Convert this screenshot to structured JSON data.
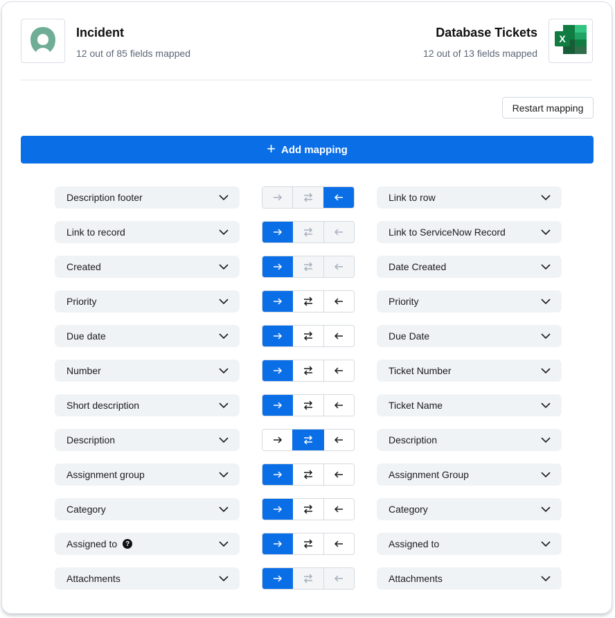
{
  "source": {
    "title": "Incident",
    "subtitle": "12 out of 85 fields mapped",
    "icon": "servicenow-logo-icon",
    "icon_color": "#6fad96"
  },
  "target": {
    "title": "Database Tickets",
    "subtitle": "12 out of 13 fields mapped",
    "icon": "excel-logo-icon"
  },
  "actions": {
    "restart_label": "Restart mapping",
    "add_label": "Add mapping",
    "add_icon": "plus-icon"
  },
  "colors": {
    "accent": "#0a6ee6",
    "field_bg": "#f0f3f6",
    "disabled_arrow": "#a7b0bd"
  },
  "direction_options": [
    "to-target",
    "two-way",
    "to-source"
  ],
  "mappings": [
    {
      "left": "Description footer",
      "right": "Link to row",
      "direction": "to-source",
      "two_way_enabled": false,
      "help": false
    },
    {
      "left": "Link to record",
      "right": "Link to ServiceNow Record",
      "direction": "to-target",
      "two_way_enabled": false,
      "help": false
    },
    {
      "left": "Created",
      "right": "Date Created",
      "direction": "to-target",
      "two_way_enabled": false,
      "help": false
    },
    {
      "left": "Priority",
      "right": "Priority",
      "direction": "to-target",
      "two_way_enabled": true,
      "help": false
    },
    {
      "left": "Due date",
      "right": "Due Date",
      "direction": "to-target",
      "two_way_enabled": true,
      "help": false
    },
    {
      "left": "Number",
      "right": "Ticket Number",
      "direction": "to-target",
      "two_way_enabled": true,
      "help": false
    },
    {
      "left": "Short description",
      "right": "Ticket Name",
      "direction": "to-target",
      "two_way_enabled": true,
      "help": false
    },
    {
      "left": "Description",
      "right": "Description",
      "direction": "two-way",
      "two_way_enabled": true,
      "help": false
    },
    {
      "left": "Assignment group",
      "right": "Assignment Group",
      "direction": "to-target",
      "two_way_enabled": true,
      "help": false
    },
    {
      "left": "Category",
      "right": "Category",
      "direction": "to-target",
      "two_way_enabled": true,
      "help": false
    },
    {
      "left": "Assigned to",
      "right": "Assigned to",
      "direction": "to-target",
      "two_way_enabled": true,
      "help": true
    },
    {
      "left": "Attachments",
      "right": "Attachments",
      "direction": "to-target",
      "two_way_enabled": false,
      "help": false
    }
  ]
}
